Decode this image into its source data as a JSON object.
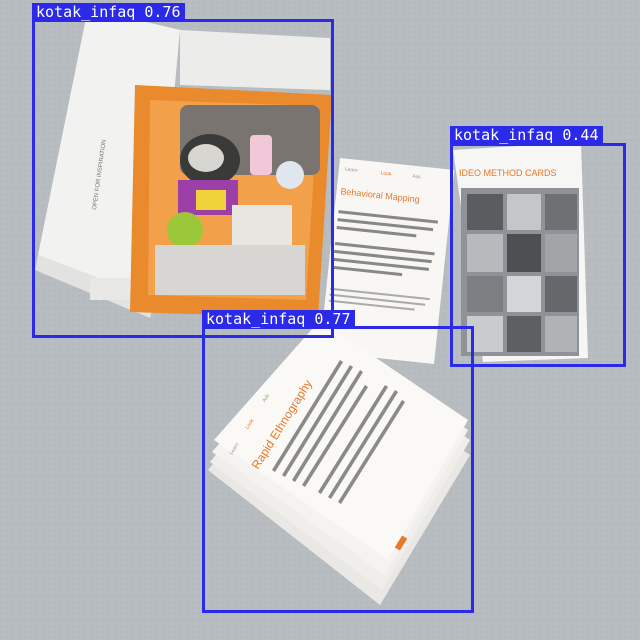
{
  "detections": [
    {
      "label": "kotak_infaq 0.76"
    },
    {
      "label": "kotak_infaq 0.44"
    },
    {
      "label": "kotak_infaq 0.77"
    }
  ],
  "photo_text": {
    "box_side": "OPEN FOR INSPIRATION",
    "card_mapping_title": "Behavioral Mapping",
    "card_mapping_nav": [
      "Learn",
      "Look",
      "Ask"
    ],
    "card_cover_title": "IDEO METHOD CARDS",
    "card_ethno_title": "Rapid Ethnography",
    "card_ethno_nav": [
      "Learn",
      "Look",
      "Ask"
    ]
  },
  "colors": {
    "box_color": "#2a2ae8",
    "card_accent": "#e8782a",
    "table": "#b9bec3"
  }
}
